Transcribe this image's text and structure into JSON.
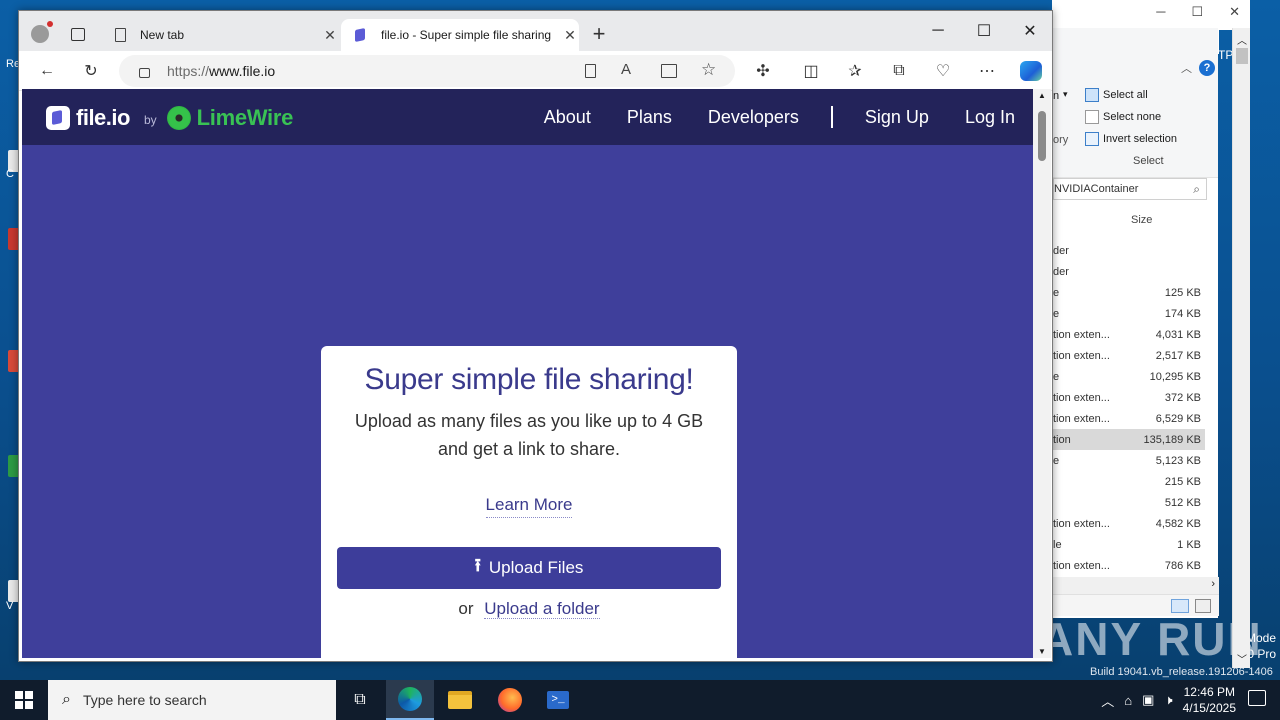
{
  "desktop": {
    "left_texts": [
      "Re",
      "C",
      "V"
    ],
    "right_texts": [
      "Mode",
      "0 Pro"
    ],
    "build": "Build 19041.vb_release.191206-1406",
    "watermark": "ANY RUN"
  },
  "explorer": {
    "ribbon": {
      "select_all": "Select all",
      "select_none": "Select none",
      "invert_selection": "Invert selection",
      "group_label": "Select",
      "partial_left_1": "n",
      "partial_left_2": "ory"
    },
    "search_value": "NVIDIAContainer",
    "size_header": "Size",
    "rows": [
      {
        "type": "der",
        "size": ""
      },
      {
        "type": "der",
        "size": ""
      },
      {
        "type": "e",
        "size": "125 KB"
      },
      {
        "type": "e",
        "size": "174 KB"
      },
      {
        "type": "tion exten...",
        "size": "4,031 KB"
      },
      {
        "type": "tion exten...",
        "size": "2,517 KB"
      },
      {
        "type": "e",
        "size": "10,295 KB"
      },
      {
        "type": "tion exten...",
        "size": "372 KB"
      },
      {
        "type": "tion exten...",
        "size": "6,529 KB"
      },
      {
        "type": "tion",
        "size": "135,189 KB"
      },
      {
        "type": "e",
        "size": "5,123 KB"
      },
      {
        "type": "",
        "size": "215 KB"
      },
      {
        "type": "",
        "size": "512 KB"
      },
      {
        "type": "tion exten...",
        "size": "4,582 KB"
      },
      {
        "type": "le",
        "size": "1 KB"
      },
      {
        "type": "tion exten...",
        "size": "786 KB"
      }
    ],
    "tp_text": "TP"
  },
  "browser": {
    "tabs": [
      {
        "title": "New tab"
      },
      {
        "title": "file.io - Super simple file sharing"
      }
    ],
    "url_proto": "https://",
    "url_host": "www.file.io"
  },
  "site": {
    "logo_text": "file.io",
    "by": "by",
    "limewire": "LimeWire",
    "nav": [
      "About",
      "Plans",
      "Developers",
      "Sign Up",
      "Log In"
    ],
    "hero_title": "Super simple file sharing!",
    "hero_sub": "Upload as many files as you like up to 4 GB and get a link to share.",
    "learn_more": "Learn More",
    "upload_files": "Upload Files",
    "or": "or",
    "upload_folder": "Upload a folder"
  },
  "taskbar": {
    "search_placeholder": "Type here to search",
    "time": "12:46 PM",
    "date": "4/15/2025"
  },
  "colors": {
    "page_bg": "#3f3f9b",
    "nav_bg": "#23235a",
    "brand": "#3a3a8c",
    "limewire_green": "#39c254"
  }
}
